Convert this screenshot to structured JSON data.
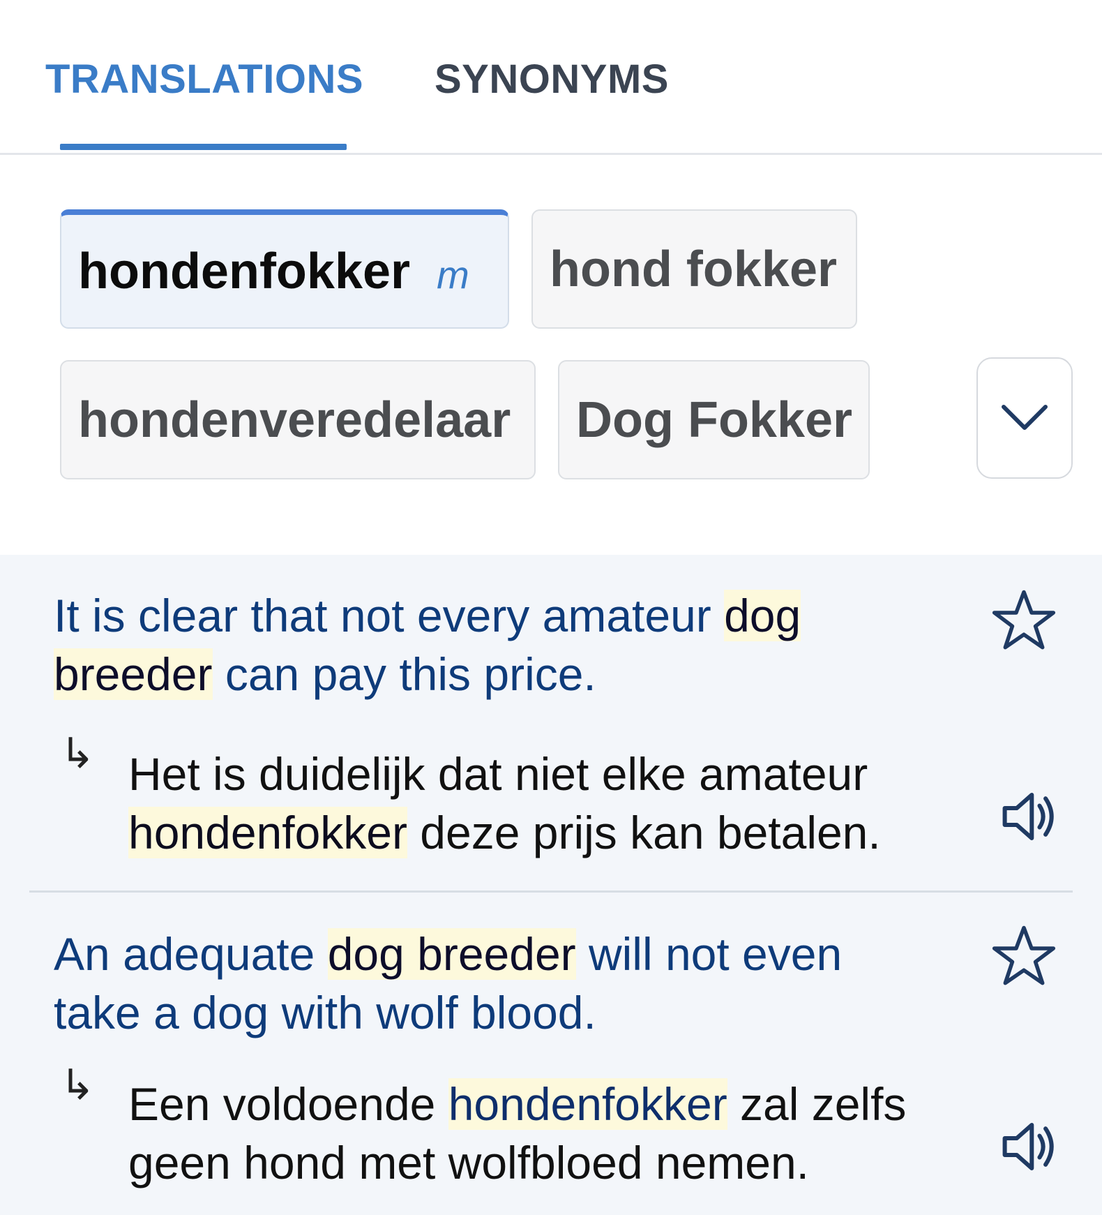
{
  "tabs": {
    "translations": "TRANSLATIONS",
    "synonyms": "SYNONYMS",
    "active": "translations"
  },
  "translations": {
    "primary": {
      "word": "hondenfokker",
      "gender": "m"
    },
    "alternatives": [
      "hond fokker",
      "hondenveredelaar",
      "Dog Fokker"
    ],
    "expand_icon": "chevron-down-icon"
  },
  "examples": [
    {
      "source_pre": "It is clear that not every amateur ",
      "source_highlight": "dog breeder",
      "source_post": " can pay this price.",
      "target_pre": "Het is duidelijk dat niet elke amateur ",
      "target_highlight": "hondenfokker",
      "target_post": " deze prijs kan betalen."
    },
    {
      "source_pre": "An adequate ",
      "source_highlight": "dog breeder",
      "source_post": " will not even take a dog with wolf blood.",
      "target_pre": "Een voldoende ",
      "target_highlight": "hondenfokker",
      "target_post": " zal zelfs geen hond met wolfbloed nemen."
    }
  ],
  "icons": {
    "arrow": "↳",
    "star": "star-icon",
    "speaker": "speaker-icon"
  },
  "colors": {
    "accent": "#3a7cc7",
    "source_text": "#0e3b7a",
    "highlight": "#fdf9dc",
    "examples_bg": "#f3f6fa"
  }
}
